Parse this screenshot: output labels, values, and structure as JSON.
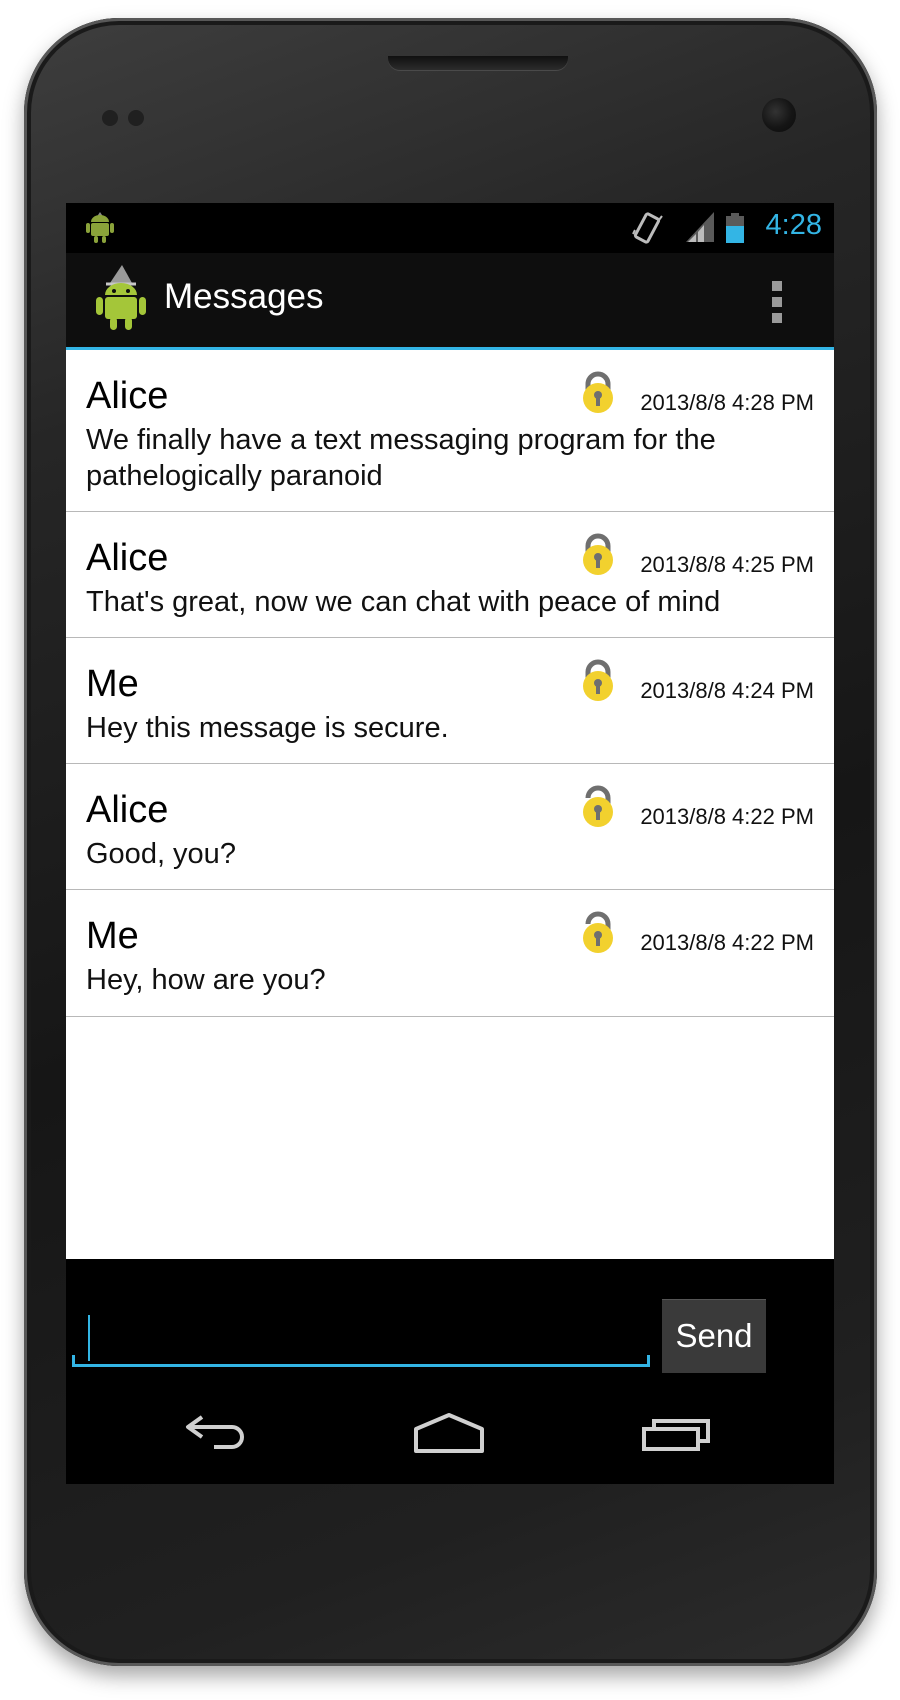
{
  "status_bar": {
    "time": "4:28",
    "icons": [
      "android-notification-icon",
      "vibrate-icon",
      "signal-icon",
      "battery-icon"
    ],
    "accent_color": "#33b5e5"
  },
  "action_bar": {
    "title": "Messages",
    "logo_icon": "android-wizard-logo-icon",
    "overflow_icon": "overflow-menu-icon"
  },
  "messages": [
    {
      "sender": "Alice",
      "timestamp": "2013/8/8 4:28 PM",
      "text": "We finally have a text messaging program for the pathelogically paranoid",
      "lock": "locked"
    },
    {
      "sender": "Alice",
      "timestamp": "2013/8/8 4:25 PM",
      "text": "That's great, now we can chat with peace of mind",
      "lock": "locked"
    },
    {
      "sender": "Me",
      "timestamp": "2013/8/8 4:24 PM",
      "text": "Hey this message is secure.",
      "lock": "locked"
    },
    {
      "sender": "Alice",
      "timestamp": "2013/8/8 4:22 PM",
      "text": "Good, you?",
      "lock": "unlocked"
    },
    {
      "sender": "Me",
      "timestamp": "2013/8/8 4:22 PM",
      "text": "Hey, how are you?",
      "lock": "unlocked"
    }
  ],
  "composer": {
    "value": "",
    "send_label": "Send"
  },
  "nav_bar": {
    "buttons": [
      "back-icon",
      "home-icon",
      "recent-apps-icon"
    ]
  },
  "colors": {
    "lock_yellow": "#f2d12e",
    "lock_shackle": "#6f6f6f"
  }
}
